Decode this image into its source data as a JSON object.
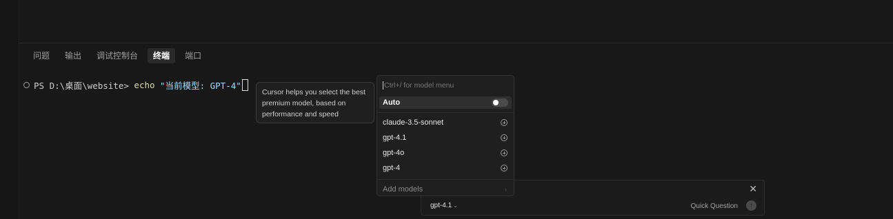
{
  "panel_tabs": [
    {
      "label": "问题",
      "active": false
    },
    {
      "label": "输出",
      "active": false
    },
    {
      "label": "调试控制台",
      "active": false
    },
    {
      "label": "终端",
      "active": true
    },
    {
      "label": "端口",
      "active": false
    }
  ],
  "terminal": {
    "prompt": "PS D:\\桌面\\website> ",
    "command": "echo",
    "argument": " \"当前模型: GPT-4\""
  },
  "tooltip": {
    "text": "Cursor helps you select the best premium model, based on performance and speed"
  },
  "model_menu": {
    "search_placeholder": "Ctrl+/ for model menu",
    "auto_label": "Auto",
    "auto_enabled": false,
    "models": [
      "claude-3.5-sonnet",
      "gpt-4.1",
      "gpt-4o",
      "gpt-4"
    ],
    "add_models_label": "Add models"
  },
  "chat": {
    "model_label": "gpt-4.1",
    "quick_question_label": "Quick Question",
    "close_glyph": "✕",
    "send_glyph": "↑"
  }
}
